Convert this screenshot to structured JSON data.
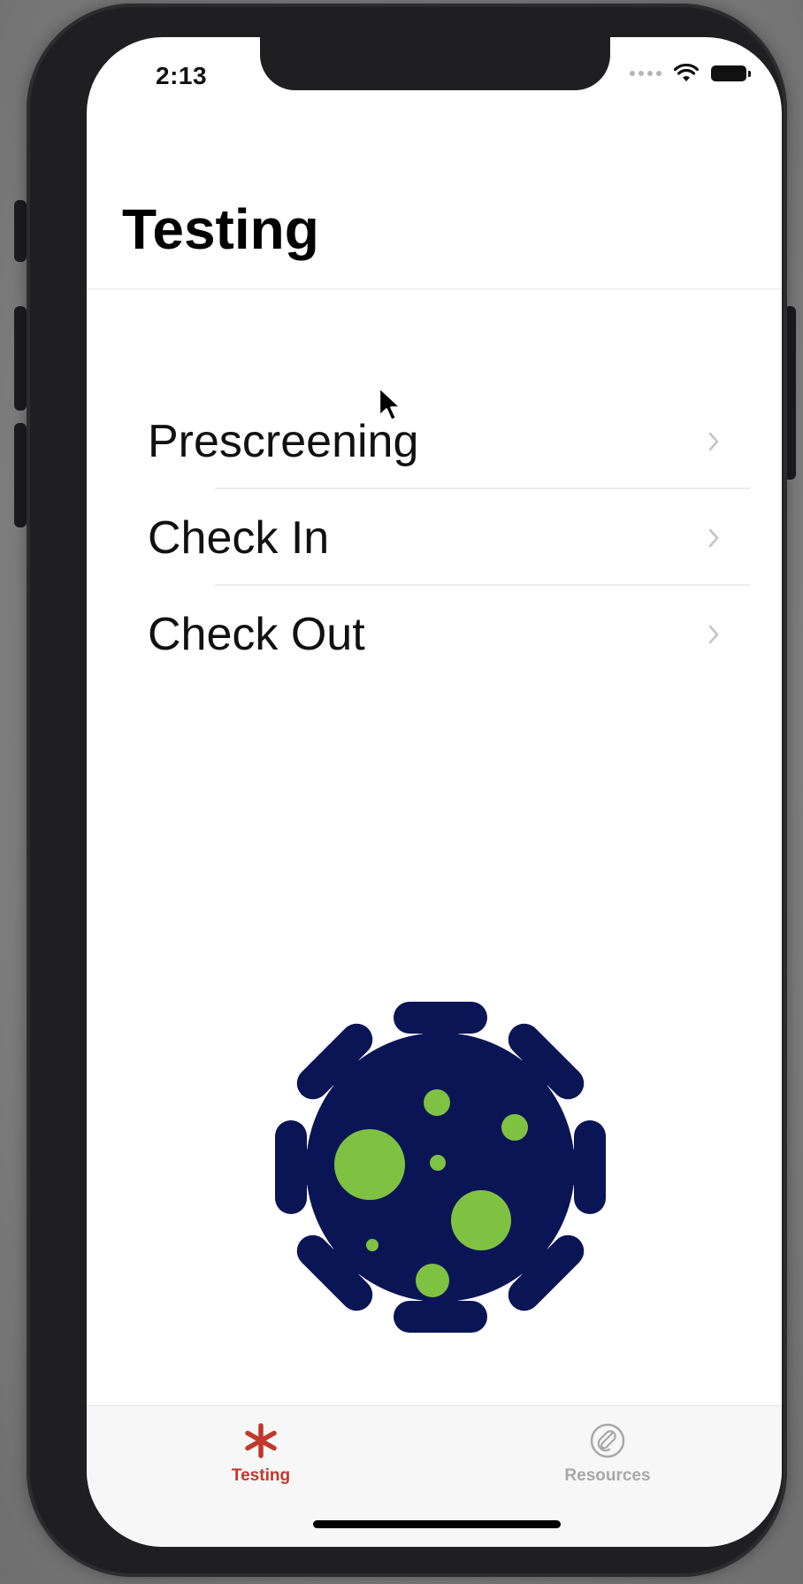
{
  "status_bar": {
    "time": "2:13",
    "icons": [
      "cellular-signal-icon",
      "wifi-icon",
      "battery-icon"
    ]
  },
  "nav": {
    "title": "Testing"
  },
  "menu": {
    "items": [
      {
        "label": "Prescreening",
        "icon": "chevron-right-icon"
      },
      {
        "label": "Check In",
        "icon": "chevron-right-icon"
      },
      {
        "label": "Check Out",
        "icon": "chevron-right-icon"
      }
    ]
  },
  "illustration": {
    "icon": "virus-icon",
    "colors": {
      "body": "#0a1556",
      "spots": "#7fc241"
    }
  },
  "tab_bar": {
    "tabs": [
      {
        "label": "Testing",
        "icon": "asterisk-icon",
        "selected": true
      },
      {
        "label": "Resources",
        "icon": "paperclip-icon",
        "selected": false
      }
    ]
  },
  "colors": {
    "accent": "#c0392b",
    "tab_inactive": "#a8a8a8",
    "chevron": "#c4c4c4"
  }
}
